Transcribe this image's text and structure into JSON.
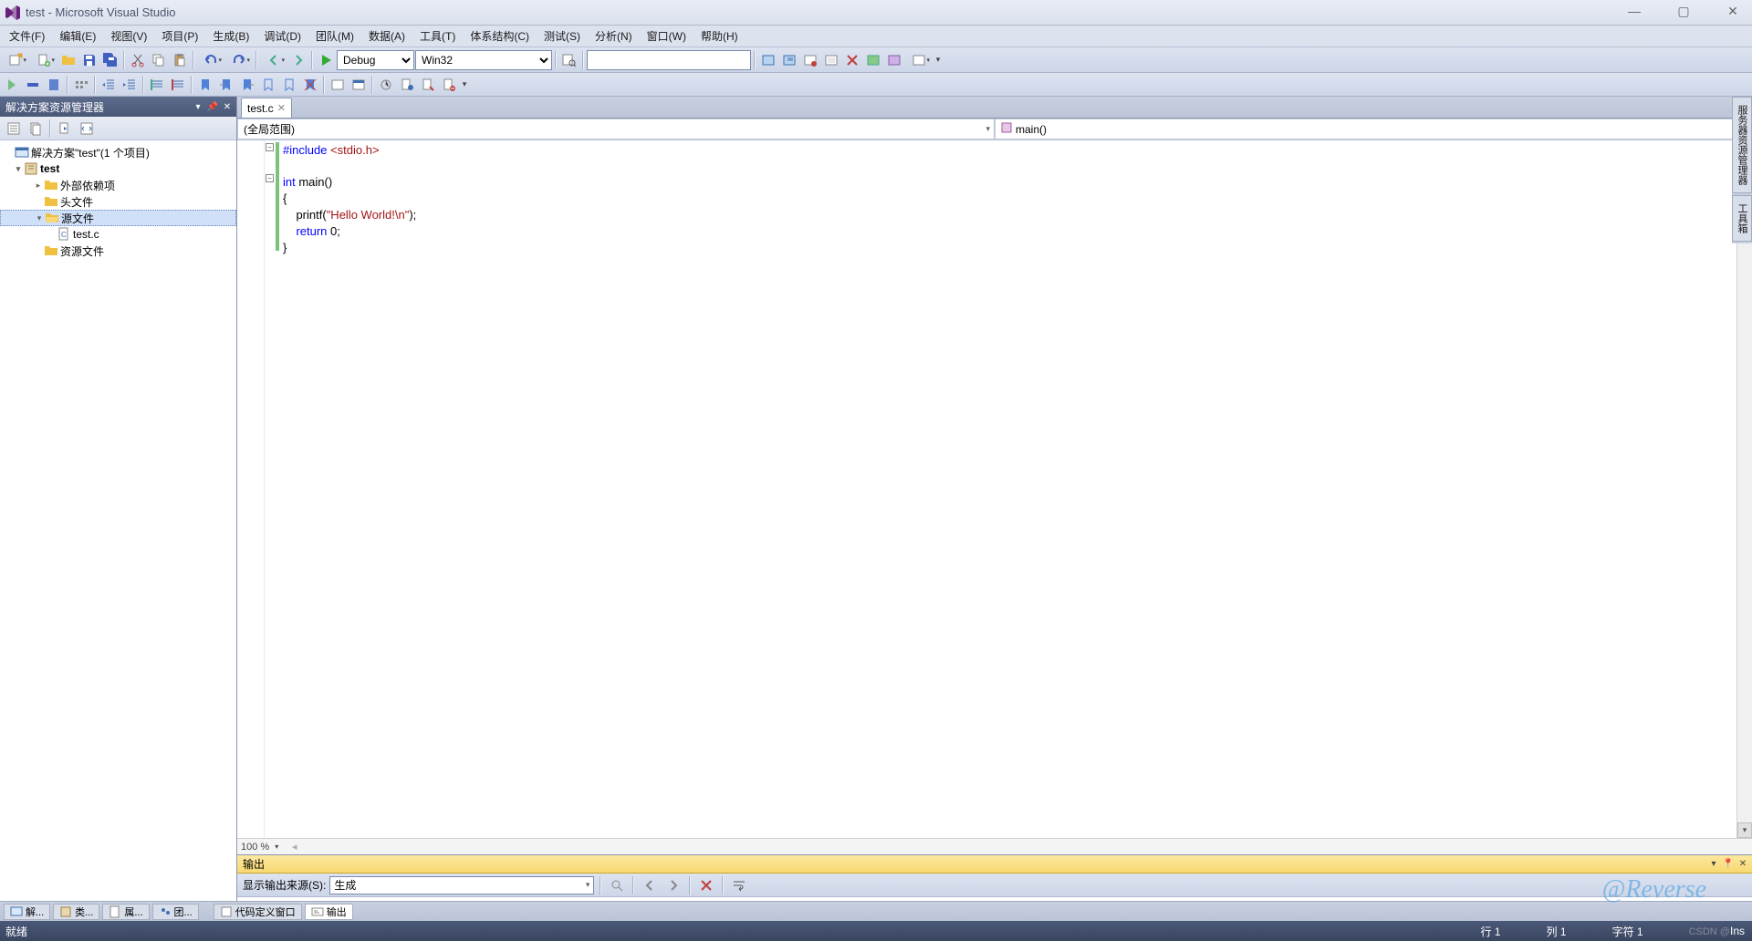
{
  "title": "test - Microsoft Visual Studio",
  "menu": {
    "file": "文件(F)",
    "edit": "编辑(E)",
    "view": "视图(V)",
    "project": "项目(P)",
    "build": "生成(B)",
    "debug": "调试(D)",
    "team": "团队(M)",
    "data": "数据(A)",
    "tools": "工具(T)",
    "architecture": "体系结构(C)",
    "test": "测试(S)",
    "analyze": "分析(N)",
    "window": "窗口(W)",
    "help": "帮助(H)"
  },
  "toolbar": {
    "config": "Debug",
    "platform": "Win32",
    "find": ""
  },
  "solution_explorer": {
    "title": "解决方案资源管理器",
    "root": "解决方案\"test\"(1 个项目)",
    "project": "test",
    "folders": {
      "external": "外部依赖项",
      "headers": "头文件",
      "sources": "源文件",
      "resources": "资源文件"
    },
    "files": {
      "testc": "test.c"
    }
  },
  "editor": {
    "tab": "test.c",
    "scope": "(全局范围)",
    "member": "main()",
    "zoom": "100 %",
    "code": {
      "l1_kw": "#include",
      "l1_file": " <stdio.h>",
      "l3": "int main()",
      "l3_kw": "int",
      "l3_rest": " main()",
      "l4": "{",
      "l5_a": "    printf(",
      "l5_str": "\"Hello World!\\n\"",
      "l5_b": ");",
      "l6_a": "    ",
      "l6_kw": "return",
      "l6_b": " 0;",
      "l7": "}"
    }
  },
  "output": {
    "title": "输出",
    "source_label": "显示输出来源(S):",
    "source_value": "生成",
    "body": ""
  },
  "bottom_tabs": {
    "t1": "解...",
    "t2": "类...",
    "t3": "属...",
    "t4": "团...",
    "t5": "代码定义窗口",
    "t6": "输出"
  },
  "status": {
    "ready": "就绪",
    "line": "行 1",
    "col": "列 1",
    "char": "字符 1",
    "ins": "Ins",
    "csdn": "CSDN @"
  },
  "right_sidebar": {
    "tab1": "服务器资源管理器",
    "tab2": "工具箱"
  },
  "watermark": "@Reverse"
}
